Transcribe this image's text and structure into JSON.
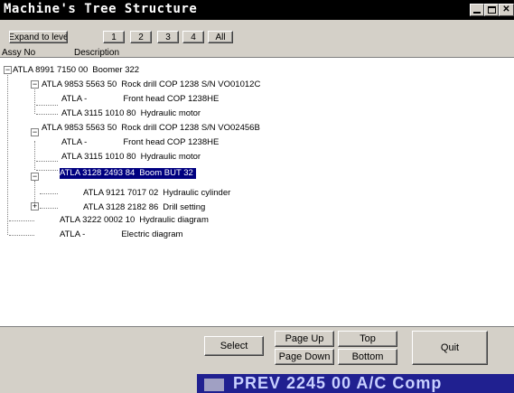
{
  "window": {
    "title": "Machine's Tree Structure"
  },
  "toolbar": {
    "expand_label": "Expand to leve",
    "level1": "1",
    "level2": "2",
    "level3": "3",
    "level4": "4",
    "all": "All"
  },
  "columns": {
    "assy": "Assy No",
    "description": "Description"
  },
  "tree": [
    {
      "code": "ATLA  8991 7150 00",
      "desc": "Boomer 322"
    },
    {
      "code": "ATLA  9853 5563 50",
      "desc": "Rock drill COP 1238 S/N VO01012C"
    },
    {
      "code": "ATLA  -",
      "desc": "Front head COP 1238HE"
    },
    {
      "code": "ATLA  3115 1010 80",
      "desc": "Hydraulic motor"
    },
    {
      "code": "ATLA  9853 5563 50",
      "desc": "Rock drill COP 1238 S/N VO02456B"
    },
    {
      "code": "ATLA  -",
      "desc": "Front head COP 1238HE"
    },
    {
      "code": "ATLA  3115 1010 80",
      "desc": "Hydraulic motor"
    },
    {
      "code": "ATLA  3128 2493 84",
      "desc": "Boom BUT 32"
    },
    {
      "code": "ATLA  9121 7017 02",
      "desc": "Hydraulic cylinder"
    },
    {
      "code": "ATLA  3128 2182 86",
      "desc": "Drill setting"
    },
    {
      "code": "ATLA  3222 0002 10",
      "desc": "Hydraulic diagram"
    },
    {
      "code": "ATLA  -",
      "desc": "Electric diagram"
    }
  ],
  "buttons": {
    "select": "Select",
    "page_up": "Page Up",
    "top": "Top",
    "page_down": "Page Down",
    "bottom": "Bottom",
    "quit": "Quit"
  },
  "status": {
    "text": "PREV  2245 00  A/C Comp"
  },
  "colors": {
    "selection": "#000080",
    "titlebar": "#000000",
    "status": "#202090"
  }
}
